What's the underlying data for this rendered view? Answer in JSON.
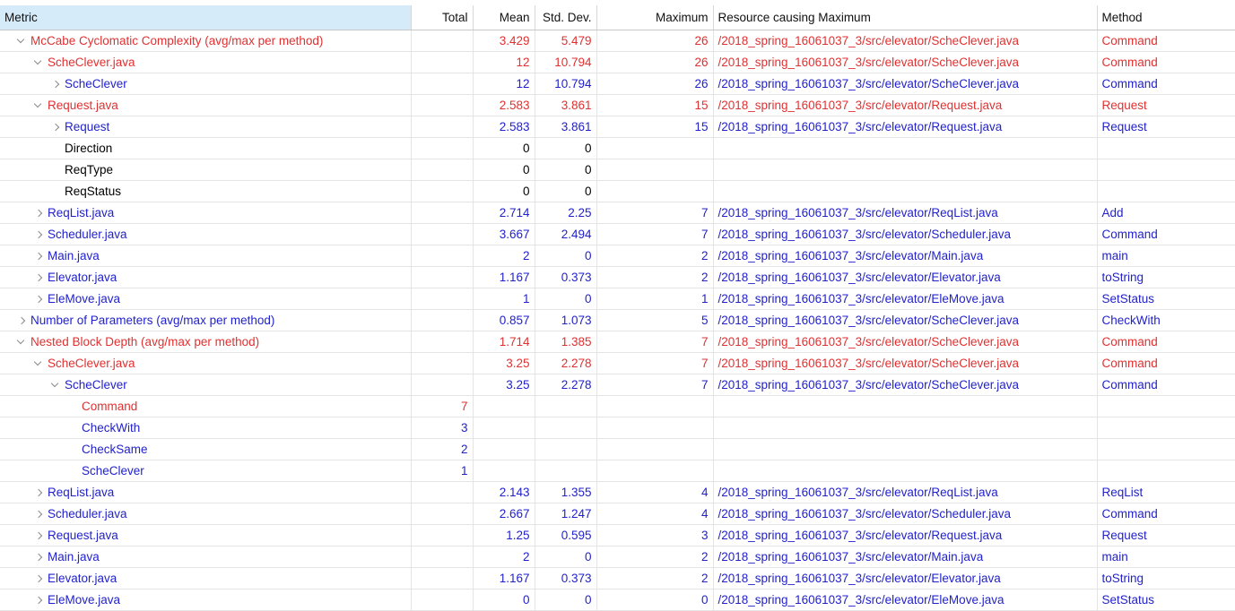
{
  "table": {
    "columns": [
      {
        "key": "metric",
        "label": "Metric",
        "align": "left",
        "selected": true
      },
      {
        "key": "total",
        "label": "Total",
        "align": "right",
        "selected": false
      },
      {
        "key": "mean",
        "label": "Mean",
        "align": "right",
        "selected": false
      },
      {
        "key": "stddev",
        "label": "Std. Dev.",
        "align": "right",
        "selected": false
      },
      {
        "key": "maximum",
        "label": "Maximum",
        "align": "right",
        "selected": false
      },
      {
        "key": "resource",
        "label": "Resource causing Maximum",
        "align": "left",
        "selected": false
      },
      {
        "key": "method",
        "label": "Method",
        "align": "left",
        "selected": false
      }
    ],
    "colors": {
      "red": "#e03131",
      "blue": "#2222cc",
      "black": "#000000",
      "header_selected_bg": "#d6ebfa",
      "grid": "#e4e4e4"
    },
    "rows": [
      {
        "metric": "McCabe Cyclomatic Complexity (avg/max per method)",
        "indent": 0,
        "twisty": "open",
        "color": "red",
        "total": "",
        "mean": "3.429",
        "stddev": "5.479",
        "maximum": "26",
        "resource": "/2018_spring_16061037_3/src/elevator/ScheClever.java",
        "method": "Command"
      },
      {
        "metric": "ScheClever.java",
        "indent": 1,
        "twisty": "open",
        "color": "red",
        "total": "",
        "mean": "12",
        "stddev": "10.794",
        "maximum": "26",
        "resource": "/2018_spring_16061037_3/src/elevator/ScheClever.java",
        "method": "Command"
      },
      {
        "metric": "ScheClever",
        "indent": 2,
        "twisty": "closed",
        "color": "blue",
        "total": "",
        "mean": "12",
        "stddev": "10.794",
        "maximum": "26",
        "resource": "/2018_spring_16061037_3/src/elevator/ScheClever.java",
        "method": "Command"
      },
      {
        "metric": "Request.java",
        "indent": 1,
        "twisty": "open",
        "color": "red",
        "total": "",
        "mean": "2.583",
        "stddev": "3.861",
        "maximum": "15",
        "resource": "/2018_spring_16061037_3/src/elevator/Request.java",
        "method": "Request"
      },
      {
        "metric": "Request",
        "indent": 2,
        "twisty": "closed",
        "color": "blue",
        "total": "",
        "mean": "2.583",
        "stddev": "3.861",
        "maximum": "15",
        "resource": "/2018_spring_16061037_3/src/elevator/Request.java",
        "method": "Request"
      },
      {
        "metric": "Direction",
        "indent": 2,
        "twisty": "none",
        "color": "black",
        "total": "",
        "mean": "0",
        "stddev": "0",
        "maximum": "",
        "resource": "",
        "method": ""
      },
      {
        "metric": "ReqType",
        "indent": 2,
        "twisty": "none",
        "color": "black",
        "total": "",
        "mean": "0",
        "stddev": "0",
        "maximum": "",
        "resource": "",
        "method": ""
      },
      {
        "metric": "ReqStatus",
        "indent": 2,
        "twisty": "none",
        "color": "black",
        "total": "",
        "mean": "0",
        "stddev": "0",
        "maximum": "",
        "resource": "",
        "method": ""
      },
      {
        "metric": "ReqList.java",
        "indent": 1,
        "twisty": "closed",
        "color": "blue",
        "total": "",
        "mean": "2.714",
        "stddev": "2.25",
        "maximum": "7",
        "resource": "/2018_spring_16061037_3/src/elevator/ReqList.java",
        "method": "Add"
      },
      {
        "metric": "Scheduler.java",
        "indent": 1,
        "twisty": "closed",
        "color": "blue",
        "total": "",
        "mean": "3.667",
        "stddev": "2.494",
        "maximum": "7",
        "resource": "/2018_spring_16061037_3/src/elevator/Scheduler.java",
        "method": "Command"
      },
      {
        "metric": "Main.java",
        "indent": 1,
        "twisty": "closed",
        "color": "blue",
        "total": "",
        "mean": "2",
        "stddev": "0",
        "maximum": "2",
        "resource": "/2018_spring_16061037_3/src/elevator/Main.java",
        "method": "main"
      },
      {
        "metric": "Elevator.java",
        "indent": 1,
        "twisty": "closed",
        "color": "blue",
        "total": "",
        "mean": "1.167",
        "stddev": "0.373",
        "maximum": "2",
        "resource": "/2018_spring_16061037_3/src/elevator/Elevator.java",
        "method": "toString"
      },
      {
        "metric": "EleMove.java",
        "indent": 1,
        "twisty": "closed",
        "color": "blue",
        "total": "",
        "mean": "1",
        "stddev": "0",
        "maximum": "1",
        "resource": "/2018_spring_16061037_3/src/elevator/EleMove.java",
        "method": "SetStatus"
      },
      {
        "metric": "Number of Parameters (avg/max per method)",
        "indent": 0,
        "twisty": "closed",
        "color": "blue",
        "total": "",
        "mean": "0.857",
        "stddev": "1.073",
        "maximum": "5",
        "resource": "/2018_spring_16061037_3/src/elevator/ScheClever.java",
        "method": "CheckWith"
      },
      {
        "metric": "Nested Block Depth (avg/max per method)",
        "indent": 0,
        "twisty": "open",
        "color": "red",
        "total": "",
        "mean": "1.714",
        "stddev": "1.385",
        "maximum": "7",
        "resource": "/2018_spring_16061037_3/src/elevator/ScheClever.java",
        "method": "Command"
      },
      {
        "metric": "ScheClever.java",
        "indent": 1,
        "twisty": "open",
        "color": "red",
        "total": "",
        "mean": "3.25",
        "stddev": "2.278",
        "maximum": "7",
        "resource": "/2018_spring_16061037_3/src/elevator/ScheClever.java",
        "method": "Command"
      },
      {
        "metric": "ScheClever",
        "indent": 2,
        "twisty": "open",
        "color": "blue",
        "total": "",
        "mean": "3.25",
        "stddev": "2.278",
        "maximum": "7",
        "resource": "/2018_spring_16061037_3/src/elevator/ScheClever.java",
        "method": "Command"
      },
      {
        "metric": "Command",
        "indent": 3,
        "twisty": "none",
        "color": "red",
        "total": "7",
        "mean": "",
        "stddev": "",
        "maximum": "",
        "resource": "",
        "method": ""
      },
      {
        "metric": "CheckWith",
        "indent": 3,
        "twisty": "none",
        "color": "blue",
        "total": "3",
        "mean": "",
        "stddev": "",
        "maximum": "",
        "resource": "",
        "method": ""
      },
      {
        "metric": "CheckSame",
        "indent": 3,
        "twisty": "none",
        "color": "blue",
        "total": "2",
        "mean": "",
        "stddev": "",
        "maximum": "",
        "resource": "",
        "method": ""
      },
      {
        "metric": "ScheClever",
        "indent": 3,
        "twisty": "none",
        "color": "blue",
        "total": "1",
        "mean": "",
        "stddev": "",
        "maximum": "",
        "resource": "",
        "method": ""
      },
      {
        "metric": "ReqList.java",
        "indent": 1,
        "twisty": "closed",
        "color": "blue",
        "total": "",
        "mean": "2.143",
        "stddev": "1.355",
        "maximum": "4",
        "resource": "/2018_spring_16061037_3/src/elevator/ReqList.java",
        "method": "ReqList"
      },
      {
        "metric": "Scheduler.java",
        "indent": 1,
        "twisty": "closed",
        "color": "blue",
        "total": "",
        "mean": "2.667",
        "stddev": "1.247",
        "maximum": "4",
        "resource": "/2018_spring_16061037_3/src/elevator/Scheduler.java",
        "method": "Command"
      },
      {
        "metric": "Request.java",
        "indent": 1,
        "twisty": "closed",
        "color": "blue",
        "total": "",
        "mean": "1.25",
        "stddev": "0.595",
        "maximum": "3",
        "resource": "/2018_spring_16061037_3/src/elevator/Request.java",
        "method": "Request"
      },
      {
        "metric": "Main.java",
        "indent": 1,
        "twisty": "closed",
        "color": "blue",
        "total": "",
        "mean": "2",
        "stddev": "0",
        "maximum": "2",
        "resource": "/2018_spring_16061037_3/src/elevator/Main.java",
        "method": "main"
      },
      {
        "metric": "Elevator.java",
        "indent": 1,
        "twisty": "closed",
        "color": "blue",
        "total": "",
        "mean": "1.167",
        "stddev": "0.373",
        "maximum": "2",
        "resource": "/2018_spring_16061037_3/src/elevator/Elevator.java",
        "method": "toString"
      },
      {
        "metric": "EleMove.java",
        "indent": 1,
        "twisty": "closed",
        "color": "blue",
        "total": "",
        "mean": "0",
        "stddev": "0",
        "maximum": "0",
        "resource": "/2018_spring_16061037_3/src/elevator/EleMove.java",
        "method": "SetStatus"
      }
    ]
  }
}
